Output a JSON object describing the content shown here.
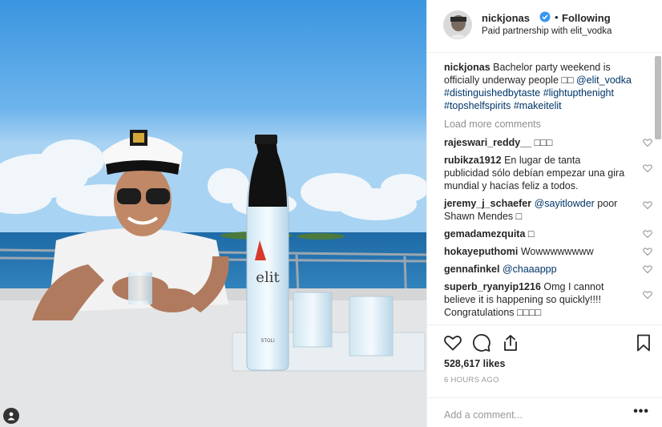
{
  "post": {
    "photo_label": "elit",
    "bottle_small_label": "STOLI"
  },
  "header": {
    "username": "nickjonas",
    "separator": "•",
    "follow_status": "Following",
    "partnership_prefix": "Paid partnership with ",
    "partner": "elit_vodka"
  },
  "caption": {
    "username": "nickjonas",
    "text": " Bachelor party weekend is officially underway people ",
    "emoji": "□□",
    "mention": " @elit_vodka",
    "hashtags": "#distinguishedbytaste #lightupthenight #topshelfspirits #makeitelit"
  },
  "load_more": "Load more comments",
  "comments": [
    {
      "username": "rajeswari_reddy__",
      "text": "□□□",
      "mention": ""
    },
    {
      "username": "rubikza1912",
      "text": "En lugar de tanta publicidad sólo debían empezar una gira mundial y hacías feliz a todos.",
      "mention": ""
    },
    {
      "username": "jeremy_j_schaefer",
      "text": "poor Shawn Mendes □",
      "mention": "@sayitlowder"
    },
    {
      "username": "gemadamezquita",
      "text": "□",
      "mention": ""
    },
    {
      "username": "hokayeputhomi",
      "text": "Wowwwwwwww",
      "mention": ""
    },
    {
      "username": "gennafinkel",
      "text": "",
      "mention": "@chaaappp"
    },
    {
      "username": "superb_ryanyip1216",
      "text": "Omg I cannot believe it is happening so quickly!!!! Congratulations □□□□",
      "mention": ""
    },
    {
      "username": "",
      "text": "",
      "mention": ""
    }
  ],
  "stats": {
    "likes": "528,617 likes",
    "time": "6 HOURS AGO"
  },
  "add_comment": {
    "placeholder": "Add a comment...",
    "more": "•••"
  },
  "icons": {
    "verified": "verified-badge-icon",
    "like": "heart-icon",
    "comment": "comment-icon",
    "share": "share-icon",
    "save": "bookmark-icon",
    "tag": "user-tag-icon",
    "more": "more-options-icon"
  },
  "colors": {
    "link": "#003569",
    "verified": "#3897f0",
    "muted": "#8e8e8e"
  }
}
